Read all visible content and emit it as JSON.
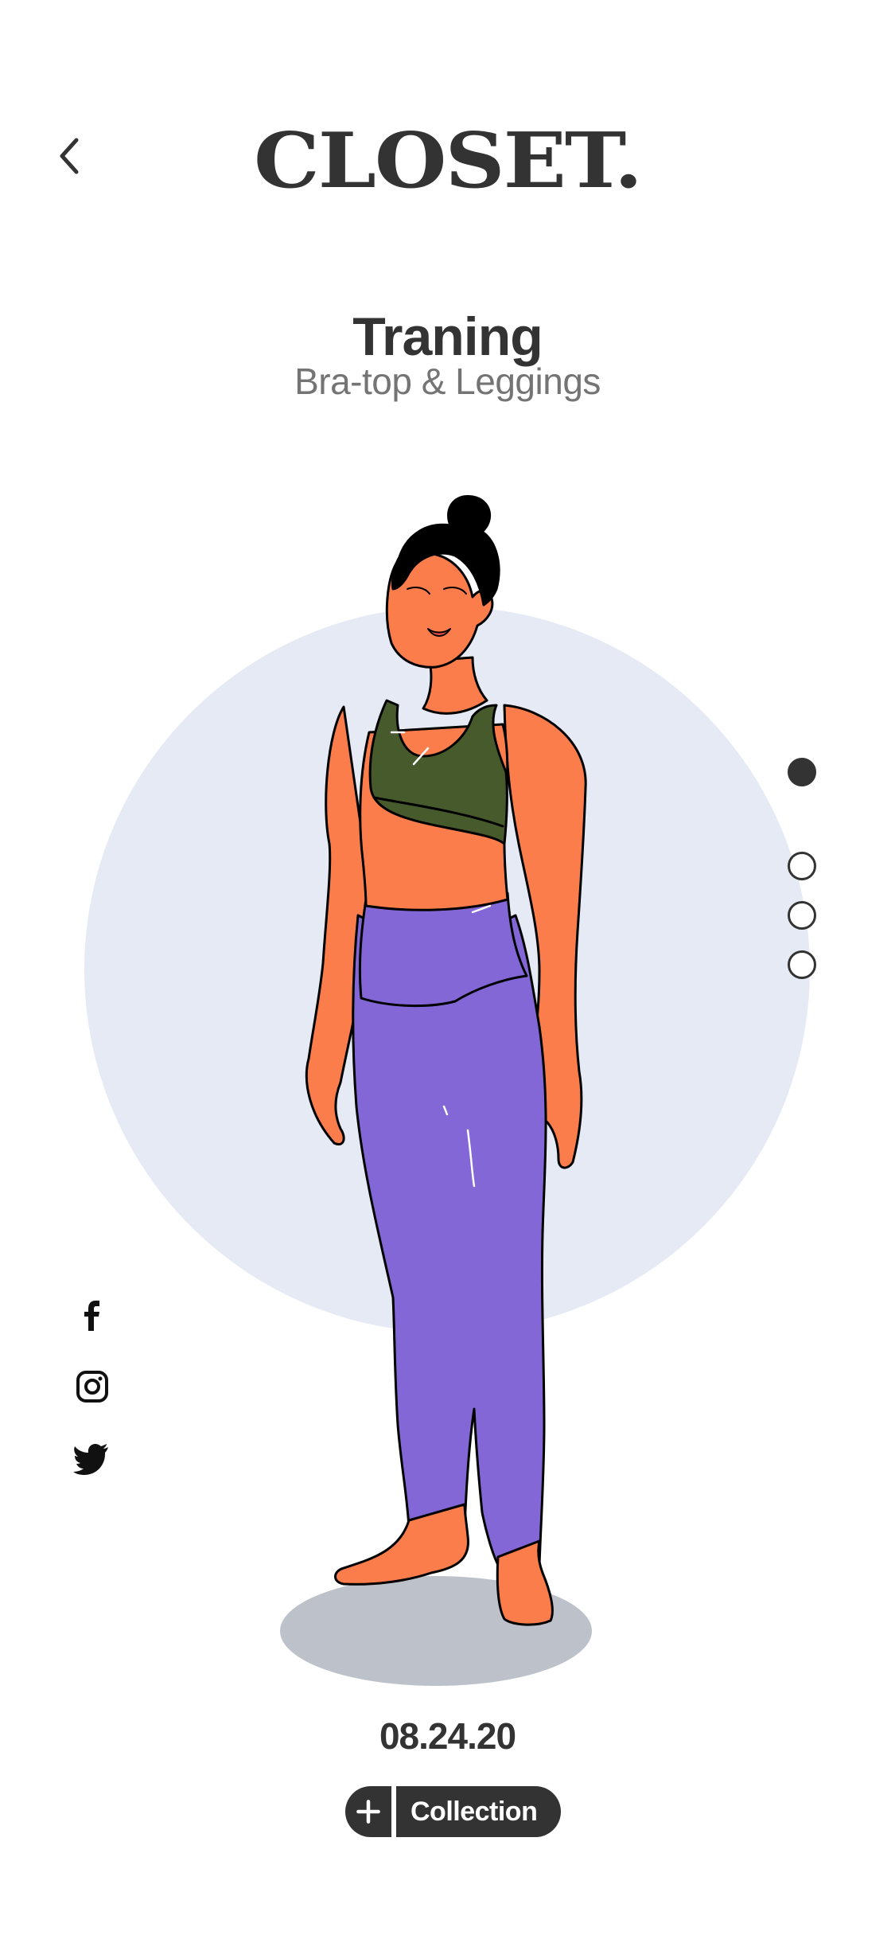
{
  "header": {
    "back_icon": "chevron-left-icon",
    "brand": "CLOSET."
  },
  "outfit": {
    "title": "Traning",
    "subtitle": "Bra-top & Leggings",
    "date": "08.24.20"
  },
  "pager": {
    "total": 4,
    "active_index": 0
  },
  "social": [
    {
      "icon": "facebook-icon"
    },
    {
      "icon": "instagram-icon"
    },
    {
      "icon": "twitter-icon"
    }
  ],
  "actions": {
    "add_icon": "plus-icon",
    "collection_label": "Collection"
  },
  "colors": {
    "text_primary": "#333333",
    "text_secondary": "#747474",
    "circle_bg": "#e5eaf5",
    "floor_shadow": "#bcc1ca",
    "skin": "#fb7d4b",
    "top": "#475a2c",
    "leggings": "#8367d6"
  }
}
